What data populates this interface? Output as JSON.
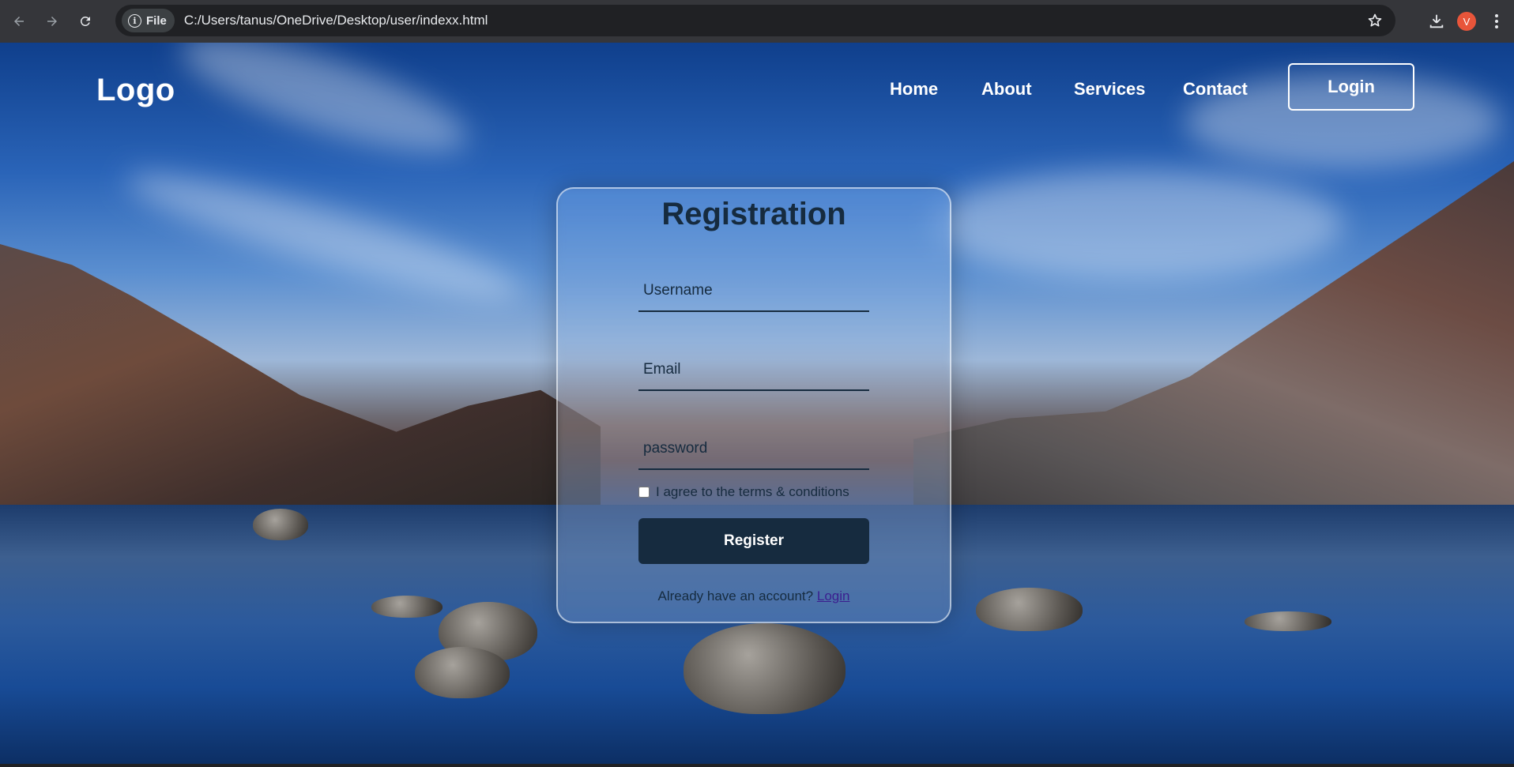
{
  "browser": {
    "site_chip": "File",
    "url": "C:/Users/tanus/OneDrive/Desktop/user/indexx.html",
    "profile_initial": "V"
  },
  "site": {
    "logo": "Logo",
    "nav": [
      "Home",
      "About",
      "Services",
      "Contact"
    ],
    "login_button": "Login"
  },
  "form": {
    "title": "Registration",
    "username_placeholder": "Username",
    "email_placeholder": "Email",
    "password_placeholder": "password",
    "terms_label": "I agree to the terms & conditions",
    "register_button": "Register",
    "already_text": "Already have an account?",
    "login_link": "Login"
  },
  "colors": {
    "accent_dark": "#162b3f",
    "avatar": "#e8553a"
  }
}
